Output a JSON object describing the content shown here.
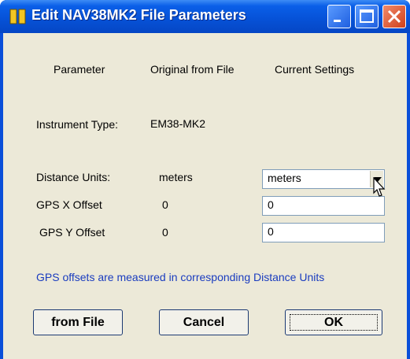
{
  "window": {
    "title": "Edit NAV38MK2 File Parameters"
  },
  "columns": {
    "parameter": "Parameter",
    "original": "Original from File",
    "current": "Current Settings"
  },
  "instrument": {
    "label": "Instrument Type:",
    "value": "EM38-MK2"
  },
  "distance_units": {
    "label": "Distance Units:",
    "original": "meters",
    "current": "meters"
  },
  "gps_x": {
    "label": "GPS X Offset",
    "original": "0",
    "current": "0"
  },
  "gps_y": {
    "label": "GPS Y Offset",
    "original": "0",
    "current": "0"
  },
  "note": "GPS offsets are measured in corresponding Distance Units",
  "buttons": {
    "from_file": "from File",
    "cancel": "Cancel",
    "ok": "OK"
  },
  "colors": {
    "titlebar": "#0651d6",
    "note_text": "#1a3cbf",
    "dialog_bg": "#ece9d8"
  },
  "icons": [
    "app-icon",
    "minimize-icon",
    "maximize-icon",
    "close-icon",
    "dropdown-arrow-icon",
    "mouse-cursor-icon"
  ]
}
